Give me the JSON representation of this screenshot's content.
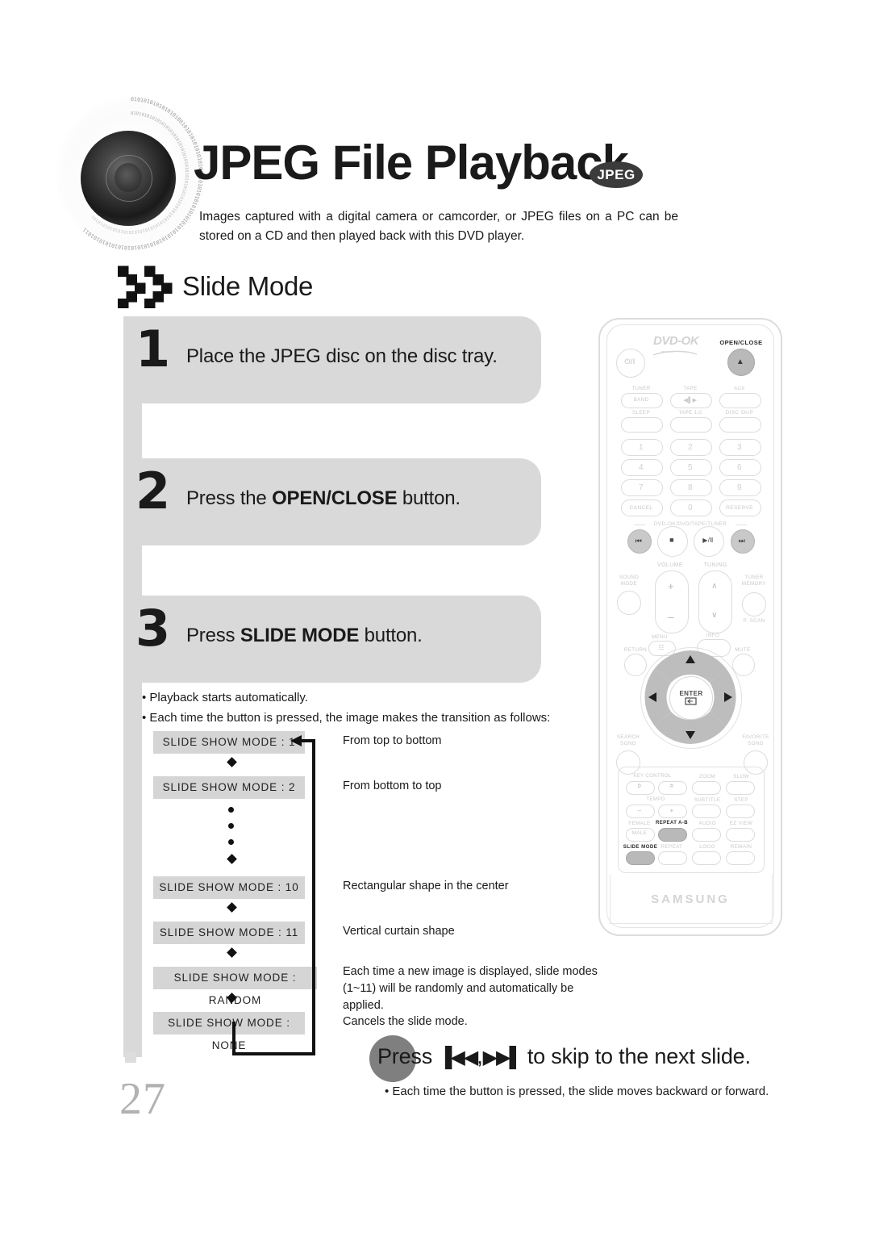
{
  "header": {
    "title": "JPEG File Playback",
    "badge": "JPEG",
    "description": "Images captured with a digital camera or camcorder, or JPEG files on a PC can be stored on a CD and then played back with this DVD player.",
    "disc_icon": "cd-disc-binary-icon"
  },
  "section": {
    "icon": "checkered-chevron-icon",
    "title": "Slide Mode"
  },
  "steps": [
    {
      "number": "1",
      "text_before": "Place the JPEG disc on the disc tray.",
      "bold": "",
      "text_after": ""
    },
    {
      "number": "2",
      "text_before": "Press the ",
      "bold": "OPEN/CLOSE",
      "text_after": " button."
    },
    {
      "number": "3",
      "text_before": "Press ",
      "bold": "SLIDE MODE",
      "text_after": " button."
    }
  ],
  "notes": [
    "• Playback starts automatically.",
    "• Each time the button is pressed, the image makes the transition as follows:"
  ],
  "flow": {
    "rows": [
      {
        "box": "SLIDE SHOW MODE : 1",
        "desc": "From top to bottom",
        "connector": "diamond",
        "wide": false
      },
      {
        "box": "SLIDE SHOW MODE : 2",
        "desc": "From bottom to top",
        "connector": "dots",
        "wide": false
      },
      {
        "box": "SLIDE SHOW MODE : 10",
        "desc": "Rectangular shape in the center",
        "connector": "diamond",
        "wide": false
      },
      {
        "box": "SLIDE SHOW MODE : 11",
        "desc": "Vertical curtain shape",
        "connector": "diamond",
        "wide": false
      },
      {
        "box": "SLIDE SHOW MODE : RANDOM",
        "desc": "Each time a new image is displayed, slide modes (1~11) will be randomly and automatically be applied.",
        "connector": "diamond",
        "wide": true
      },
      {
        "box": "SLIDE SHOW MODE : NONE",
        "desc": "Cancels the slide mode.",
        "connector": "none",
        "wide": false
      }
    ]
  },
  "skip": {
    "press_label": "Press",
    "prev_glyph": "▐◀◀",
    "separator": ",",
    "next_glyph": "▶▶▌",
    "tail": "to skip to the next slide.",
    "note": "• Each time the button is pressed, the slide moves backward or forward."
  },
  "page_number": "27",
  "remote": {
    "brand_top": "DVD-OK",
    "brand_bottom": "SAMSUNG",
    "open_close": "OPEN/CLOSE",
    "source_labels": [
      "TUNER",
      "TAPE",
      "AUX"
    ],
    "source_buttons": [
      "BAND",
      "◀▌▶",
      ""
    ],
    "row2_labels": [
      "SLEEP",
      "TAPE 1/2",
      "DISC SKIP"
    ],
    "numpad": [
      "1",
      "2",
      "3",
      "4",
      "5",
      "6",
      "7",
      "8",
      "9",
      "CANCEL",
      "0",
      "RESERVE"
    ],
    "transport_label": "DVD-OK/DVD/TAPE/TUNER",
    "transport": [
      "⏮",
      "■",
      "▶/Ⅱ",
      "⏭"
    ],
    "volume_label": "VOLUME",
    "tuning_label": "TUNING",
    "sound_mode": "SOUND MODE",
    "tuner_memory": "TUNER MEMORY",
    "p_scan": "P. SCAN",
    "menu": "MENU",
    "info": "INFO",
    "mute": "MUTE",
    "return": "RETURN",
    "enter": "ENTER",
    "search_song": "SEARCH SONG",
    "favorite_song": "FAVORITE SONG",
    "key_control": "KEY CONTROL",
    "tempo": "TEMPO",
    "keys": [
      "b",
      "#"
    ],
    "tempo_keys": [
      "–",
      "+"
    ],
    "zoom": "ZOOM",
    "slow": "SLOW",
    "subtitle": "SUBTITLE",
    "step": "STEP",
    "female": "FEMALE",
    "male": "MALE",
    "repeat_ab": "REPEAT A-B",
    "audio": "AUDIO",
    "ez_view": "EZ VIEW",
    "slide_mode": "SLIDE MODE",
    "repeat": "REPEAT",
    "logo": "LOGO",
    "remain": "REMAIN",
    "power": "⏻/I"
  },
  "colors": {
    "step_box": "#d9d9d9",
    "mode_box": "#d5d5d5",
    "badge": "#3b3b3b",
    "page_num": "#b2b2b2",
    "highlight": "#7f7f7f"
  }
}
